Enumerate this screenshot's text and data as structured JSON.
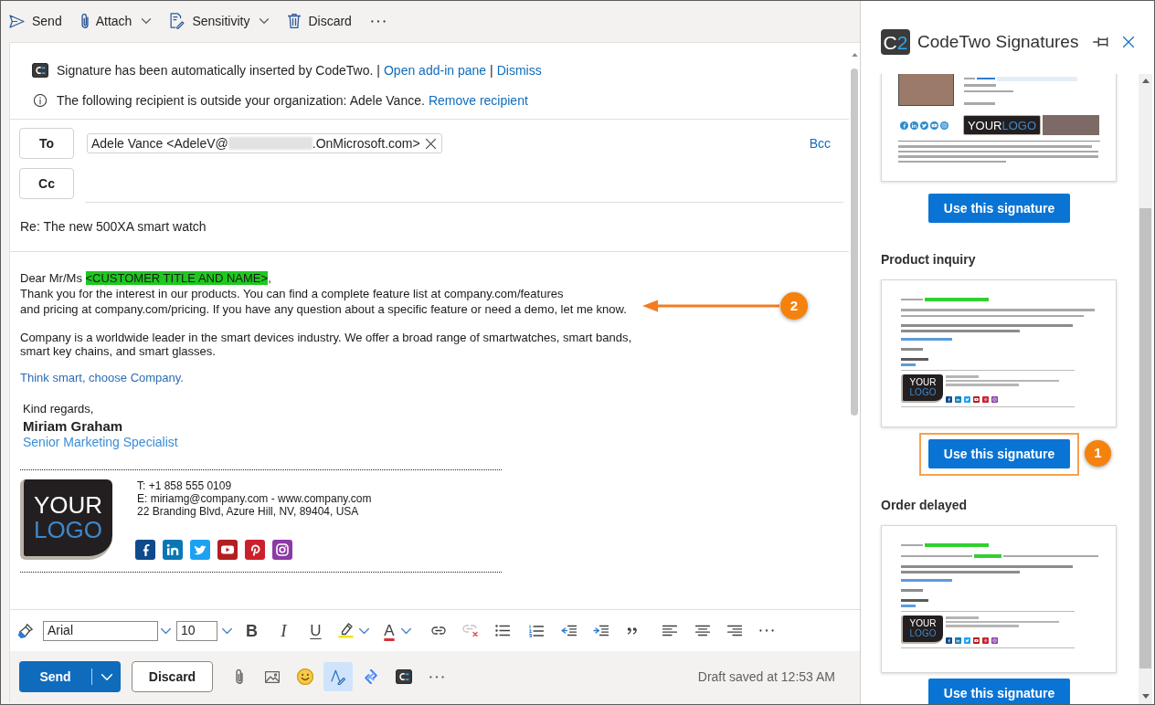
{
  "toolbar": [
    {
      "kind": "send",
      "label": "Send",
      "dropdown": false
    },
    {
      "kind": "attach",
      "label": "Attach",
      "dropdown": true
    },
    {
      "kind": "sensitivity",
      "label": "Sensitivity",
      "dropdown": true
    },
    {
      "kind": "discard",
      "label": "Discard",
      "dropdown": false
    },
    {
      "kind": "more"
    }
  ],
  "notices": [
    {
      "kind": "addin",
      "parts": [
        {
          "kind": "text",
          "text": "Signature has been automatically inserted by CodeTwo."
        },
        {
          "kind": "separator",
          "text": "|"
        },
        {
          "kind": "link",
          "text": "Open add-in pane"
        },
        {
          "kind": "separator",
          "text": "|"
        },
        {
          "kind": "link",
          "text": "Dismiss"
        }
      ]
    },
    {
      "kind": "info",
      "parts": [
        {
          "kind": "text",
          "text": "The following recipient is outside your organization: Adele Vance."
        },
        {
          "kind": "link",
          "text": "Remove recipient"
        }
      ]
    }
  ],
  "recipients": {
    "to": {
      "label": "To",
      "chips": [
        {
          "text_before_redaction": "Adele Vance <AdeleV@",
          "text_after_redaction": ".OnMicrosoft.com>"
        }
      ]
    },
    "cc": {
      "label": "Cc"
    },
    "bcc_link": "Bcc"
  },
  "subject": "Re: The new 500XA smart watch",
  "body": {
    "greeting": {
      "text": "Dear Mr/Ms",
      "placeholder": "<CUSTOMER TITLE AND NAME>",
      "end": ","
    },
    "paragraphs": [
      {
        "kind": "plain",
        "lines": [
          "Thank you for the interest in our products. You can find a complete feature list at company.com/features",
          "and pricing at company.com/pricing. If you have any question about a specific feature or need a demo, let me know."
        ]
      },
      {
        "kind": "plain",
        "lines": [
          "Company is a worldwide leader in the smart devices industry. We offer a broad range of smartwatches, smart bands,",
          "smart key chains, and smart glasses."
        ]
      },
      {
        "kind": "slogan",
        "lines": [
          "Think smart, choose Company."
        ]
      }
    ],
    "callout": "2"
  },
  "signature": {
    "closing": "Kind regards,",
    "name": "Miriam Graham",
    "title": "Senior Marketing Specialist",
    "logo": {
      "top": "YOUR",
      "bottom": "LOGO"
    },
    "contact": [
      "T: +1 858 555 0109",
      "E: miriamg@company.com - www.company.com",
      "22 Branding Blvd, Azure Hill, NV, 89404, USA"
    ],
    "social": [
      {
        "kind": "facebook",
        "color": "#0e4a8c"
      },
      {
        "kind": "linkedin",
        "color": "#0a77b5"
      },
      {
        "kind": "twitter",
        "color": "#1da1f2"
      },
      {
        "kind": "youtube",
        "color": "#b2201f"
      },
      {
        "kind": "pinterest",
        "color": "#cc1f2d"
      },
      {
        "kind": "instagram",
        "color": "#8c3aa5"
      }
    ]
  },
  "format_bar": {
    "items": [
      {
        "kind": "painter",
        "disabled": false
      },
      {
        "kind": "font",
        "value": "Arial"
      },
      {
        "kind": "size",
        "value": "10"
      },
      {
        "kind": "bold",
        "glyph": "B",
        "disabled": false
      },
      {
        "kind": "italic",
        "glyph": "I",
        "disabled": false
      },
      {
        "kind": "underline",
        "glyph": "U",
        "disabled": false
      },
      {
        "kind": "highlight",
        "disabled": false
      },
      {
        "kind": "font_color",
        "glyph": "A",
        "disabled": false
      },
      {
        "kind": "link",
        "disabled": false
      },
      {
        "kind": "unlink",
        "disabled": true
      },
      {
        "kind": "bullets",
        "disabled": false
      },
      {
        "kind": "numbering",
        "disabled": false
      },
      {
        "kind": "outdent",
        "disabled": false
      },
      {
        "kind": "indent",
        "disabled": false
      },
      {
        "kind": "quote",
        "disabled": false
      },
      {
        "kind": "align_left",
        "disabled": false
      },
      {
        "kind": "align_center",
        "disabled": false
      },
      {
        "kind": "align_right",
        "disabled": false
      },
      {
        "kind": "more",
        "disabled": false
      }
    ]
  },
  "action_bar": {
    "send": "Send",
    "discard": "Discard",
    "tools": [
      {
        "kind": "attach",
        "selected": false
      },
      {
        "kind": "image",
        "selected": false
      },
      {
        "kind": "emoji",
        "selected": false
      },
      {
        "kind": "editor",
        "selected": true
      },
      {
        "kind": "loop",
        "selected": false
      },
      {
        "kind": "addin",
        "selected": false
      },
      {
        "kind": "more",
        "selected": false
      }
    ],
    "status": "Draft saved at 12:53 AM"
  },
  "pane": {
    "logo": {
      "letter": "C",
      "digit": "2"
    },
    "title": "CodeTwo Signatures",
    "templates": [
      {
        "kind": "banner",
        "preview": {
          "social": [
            {
              "kind": "facebook"
            },
            {
              "kind": "linkedin"
            },
            {
              "kind": "twitter"
            },
            {
              "kind": "youtube"
            },
            {
              "kind": "instagram"
            }
          ],
          "logo": {
            "top": "YOUR",
            "bottom": "LOGO"
          }
        },
        "button": "Use this signature",
        "highlighted": false
      },
      {
        "kind": "letter",
        "name": "Product inquiry",
        "preview": {
          "message_lines": [
            {
              "kind": "plain"
            },
            {
              "kind": "plain"
            }
          ],
          "logo": {
            "top": "YOUR",
            "bottom": "LOGO"
          },
          "social": [
            {
              "kind": "facebook",
              "color": "#0e4a8c"
            },
            {
              "kind": "linkedin",
              "color": "#0a77b5"
            },
            {
              "kind": "twitter",
              "color": "#1da1f2"
            },
            {
              "kind": "youtube",
              "color": "#b2201f"
            },
            {
              "kind": "pinterest",
              "color": "#cc1f2d"
            },
            {
              "kind": "instagram",
              "color": "#8c3aa5"
            }
          ]
        },
        "button": "Use this signature",
        "highlighted": true,
        "callout": "1"
      },
      {
        "kind": "letter",
        "name": "Order delayed",
        "preview": {
          "message_lines": [
            {
              "kind": "placeholder"
            }
          ],
          "logo": {
            "top": "YOUR",
            "bottom": "LOGO"
          },
          "social": [
            {
              "kind": "facebook",
              "color": "#0e4a8c"
            },
            {
              "kind": "linkedin",
              "color": "#0a77b5"
            },
            {
              "kind": "twitter",
              "color": "#1da1f2"
            },
            {
              "kind": "youtube",
              "color": "#b2201f"
            },
            {
              "kind": "pinterest",
              "color": "#cc1f2d"
            },
            {
              "kind": "instagram",
              "color": "#8c3aa5"
            }
          ]
        },
        "button": "Use this signature",
        "highlighted": false
      }
    ]
  }
}
